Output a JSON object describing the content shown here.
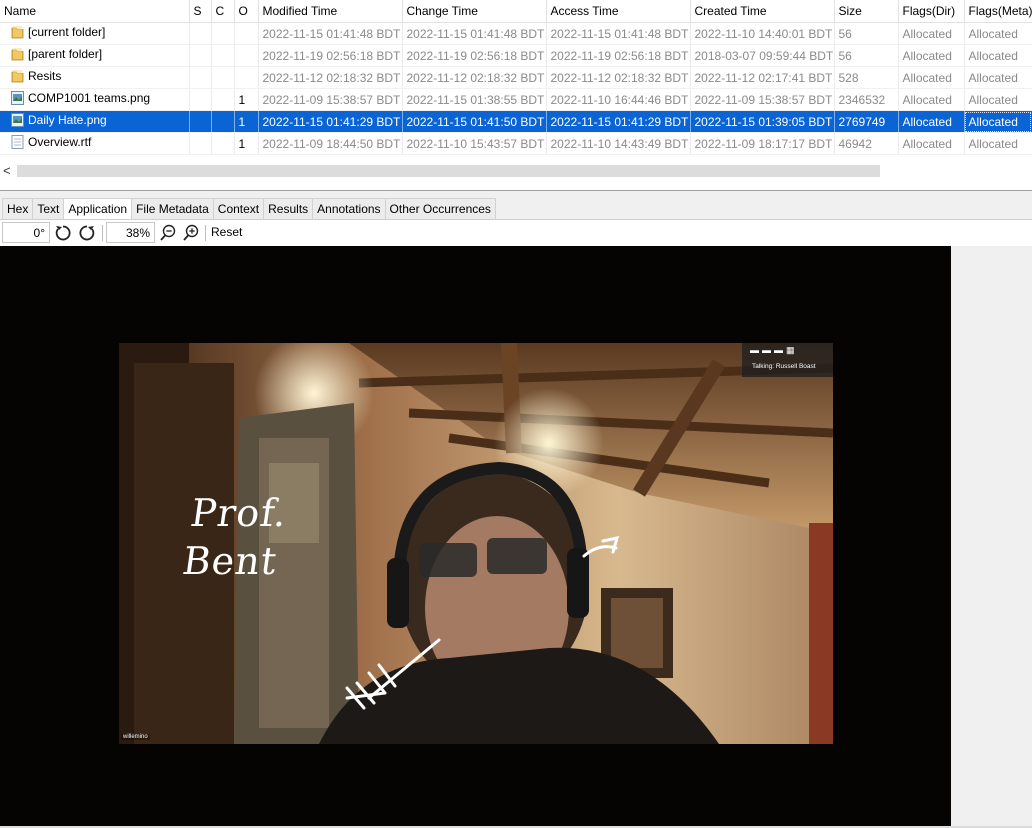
{
  "table": {
    "columns": [
      "Name",
      "S",
      "C",
      "O",
      "Modified Time",
      "Change Time",
      "Access Time",
      "Created Time",
      "Size",
      "Flags(Dir)",
      "Flags(Meta)"
    ],
    "rows": [
      {
        "icon": "folder-icon",
        "name": "[current folder]",
        "s": "",
        "c": "",
        "o": "",
        "modified": "2022-11-15 01:41:48 BDT",
        "change": "2022-11-15 01:41:48 BDT",
        "access": "2022-11-15 01:41:48 BDT",
        "created": "2022-11-10 14:40:01 BDT",
        "size": "56",
        "flags_dir": "Allocated",
        "flags_meta": "Allocated"
      },
      {
        "icon": "folder-icon",
        "name": "[parent folder]",
        "s": "",
        "c": "",
        "o": "",
        "modified": "2022-11-19 02:56:18 BDT",
        "change": "2022-11-19 02:56:18 BDT",
        "access": "2022-11-19 02:56:18 BDT",
        "created": "2018-03-07 09:59:44 BDT",
        "size": "56",
        "flags_dir": "Allocated",
        "flags_meta": "Allocated"
      },
      {
        "icon": "folder-icon",
        "name": "Resits",
        "s": "",
        "c": "",
        "o": "",
        "modified": "2022-11-12 02:18:32 BDT",
        "change": "2022-11-12 02:18:32 BDT",
        "access": "2022-11-12 02:18:32 BDT",
        "created": "2022-11-12 02:17:41 BDT",
        "size": "528",
        "flags_dir": "Allocated",
        "flags_meta": "Allocated"
      },
      {
        "icon": "image-file-icon",
        "name": "COMP1001 teams.png",
        "s": "",
        "c": "",
        "o": "1",
        "modified": "2022-11-09 15:38:57 BDT",
        "change": "2022-11-15 01:38:55 BDT",
        "access": "2022-11-10 16:44:46 BDT",
        "created": "2022-11-09 15:38:57 BDT",
        "size": "2346532",
        "flags_dir": "Allocated",
        "flags_meta": "Allocated"
      },
      {
        "icon": "image-file-icon",
        "name": "Daily Hate.png",
        "s": "",
        "c": "",
        "o": "1",
        "modified": "2022-11-15 01:41:29 BDT",
        "change": "2022-11-15 01:41:50 BDT",
        "access": "2022-11-15 01:41:29 BDT",
        "created": "2022-11-15 01:39:05 BDT",
        "size": "2769749",
        "flags_dir": "Allocated",
        "flags_meta": "Allocated",
        "selected": true
      },
      {
        "icon": "document-file-icon",
        "name": "Overview.rtf",
        "s": "",
        "c": "",
        "o": "1",
        "modified": "2022-11-09 18:44:50 BDT",
        "change": "2022-11-10 15:43:57 BDT",
        "access": "2022-11-10 14:43:49 BDT",
        "created": "2022-11-09 18:17:17 BDT",
        "size": "46942",
        "flags_dir": "Allocated",
        "flags_meta": "Allocated"
      }
    ]
  },
  "scrollbar": {
    "left_arrow": "<"
  },
  "tabs": [
    "Hex",
    "Text",
    "Application",
    "File Metadata",
    "Context",
    "Results",
    "Annotations",
    "Other Occurrences"
  ],
  "active_tab": "Application",
  "toolbar": {
    "rotation": "0°",
    "zoom": "38%",
    "reset_label": "Reset",
    "icons": [
      "rotate-left-icon",
      "rotate-right-icon",
      "zoom-out-icon",
      "zoom-in-icon"
    ]
  },
  "image": {
    "talking_label": "Talking: Russell Boast",
    "participant_name": "willemino",
    "handwriting_line1": "Prof.",
    "handwriting_line2": "Bent"
  },
  "colors": {
    "selection": "#0a64d4",
    "viewer_background": "#050403",
    "folder": "#e8b84a"
  }
}
